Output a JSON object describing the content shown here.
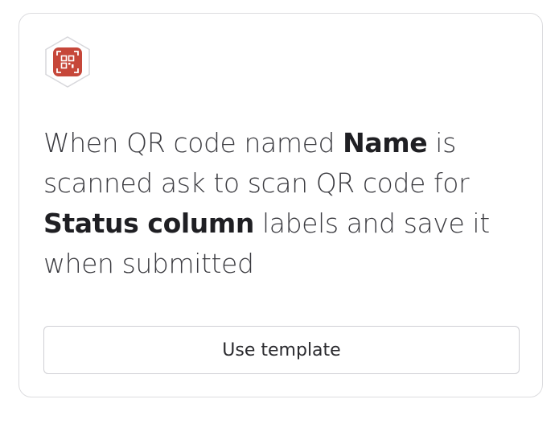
{
  "card": {
    "icon": "qr-code-scan-icon",
    "icon_color": "#c6473a",
    "description": {
      "part1": "When QR code named ",
      "field_name": "Name",
      "part2": " is scanned ask to scan QR code for ",
      "field_status": "Status column",
      "part3": " labels and save it when submitted"
    },
    "button_label": "Use template"
  }
}
